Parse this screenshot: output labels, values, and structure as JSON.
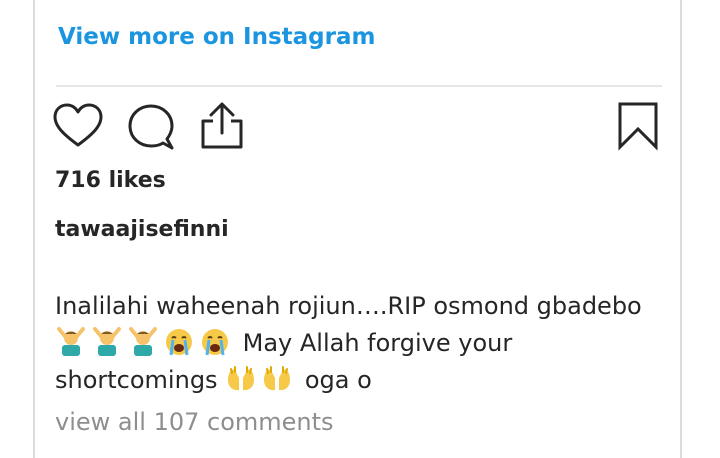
{
  "embed": {
    "view_more_label": "View more on Instagram",
    "likes_text": "716 likes",
    "username": "tawaajisefinni",
    "caption": {
      "line1": "Inalilahi waheenah rojiun….RIP osmond gbadebo",
      "line2_text": " May Allah forgive your",
      "line3_text": "shortcomings",
      "line3_tail": " oga o"
    },
    "comments_link": "view all 107 comments"
  },
  "icons": {
    "like": "heart-icon",
    "comment": "comment-bubble-icon",
    "share": "share-upload-icon",
    "save": "bookmark-icon",
    "emoji_1": "person-gesturing-no-emoji",
    "emoji_2": "loudly-crying-face-emoji",
    "emoji_3": "raising-hands-emoji"
  },
  "colors": {
    "link": "#1b95e0",
    "text": "#262626",
    "muted": "#8e8e8e",
    "border": "#dbdbdb"
  }
}
